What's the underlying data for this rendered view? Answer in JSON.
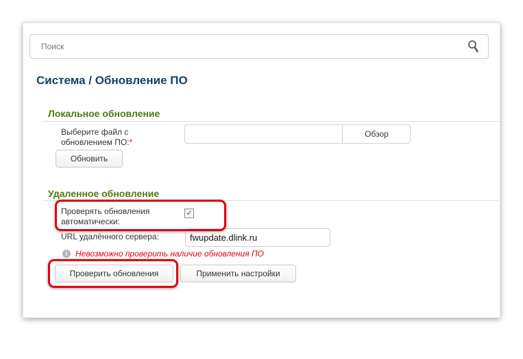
{
  "search": {
    "placeholder": "Поиск"
  },
  "breadcrumb": {
    "title": "Система /  Обновление ПО"
  },
  "local": {
    "header": "Локальное обновление",
    "file_label": "Выберите файл с обновлением ПО:",
    "required_mark": "*",
    "browse": "Обзор",
    "update": "Обновить"
  },
  "remote": {
    "header": "Удаленное обновление",
    "auto_label": "Проверять обновления автоматически:",
    "auto_checked": true,
    "checkmark": "✓",
    "url_label": "URL удалённого сервера:",
    "url_value": "fwupdate.dlink.ru",
    "error": "Невозможно проверить наличие обновления ПО",
    "info_glyph": "i",
    "check": "Проверить обновления",
    "apply": "Применить настройки"
  }
}
